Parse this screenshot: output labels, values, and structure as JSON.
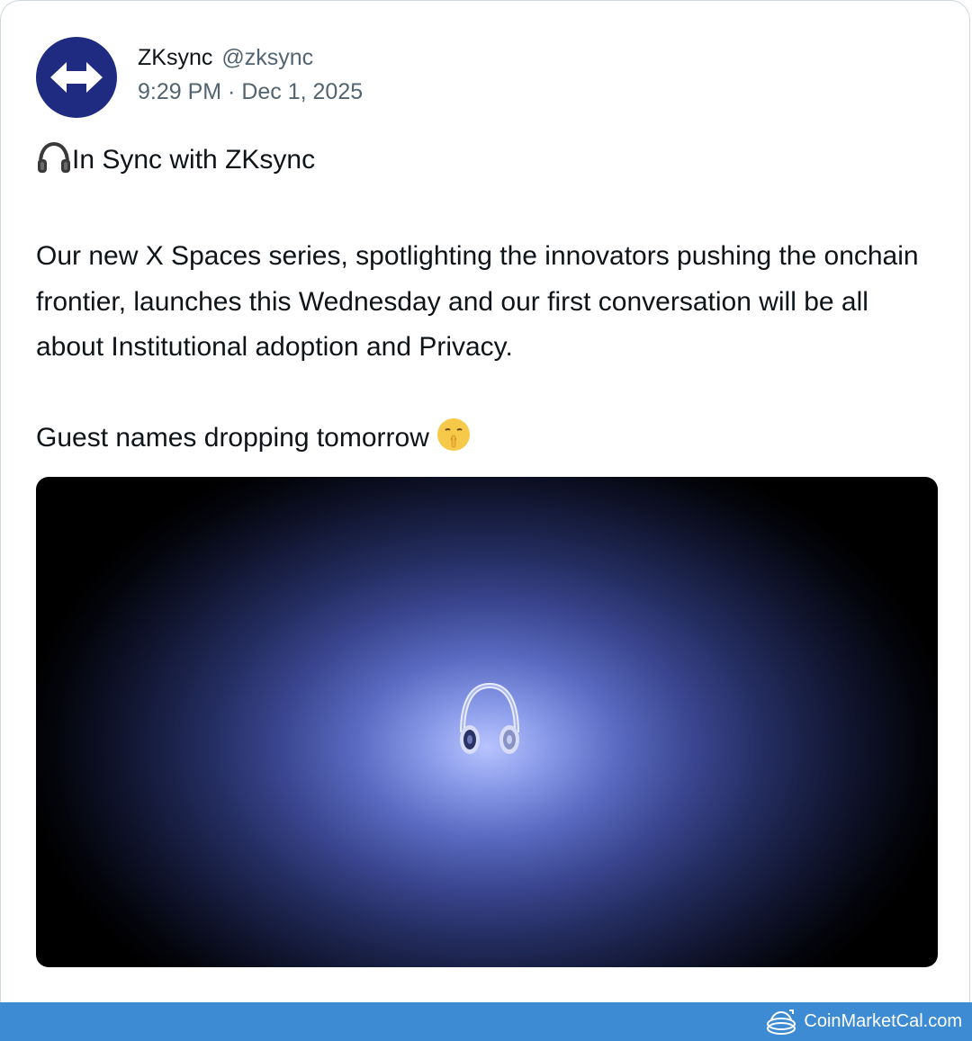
{
  "tweet": {
    "display_name": "ZKsync",
    "handle": "@zksync",
    "timestamp": "9:29 PM · Dec 1, 2025",
    "headline_emoji": "headphone-emoji",
    "headline": "In Sync with ZKsync",
    "body": "Our new X Spaces series, spotlighting the innovators pushing the onchain frontier, launches this Wednesday and our first conversation will be all about Institutional adoption and Privacy.",
    "closing": "Guest names dropping tomorrow",
    "closing_emoji": "shushing-face-emoji"
  },
  "avatar": {
    "icon": "arrows-swap-icon",
    "color": "#1e2b80"
  },
  "media": {
    "icon": "headphones-icon"
  },
  "footer": {
    "brand": "CoinMarketCal.com",
    "color": "#3d8bd3"
  }
}
